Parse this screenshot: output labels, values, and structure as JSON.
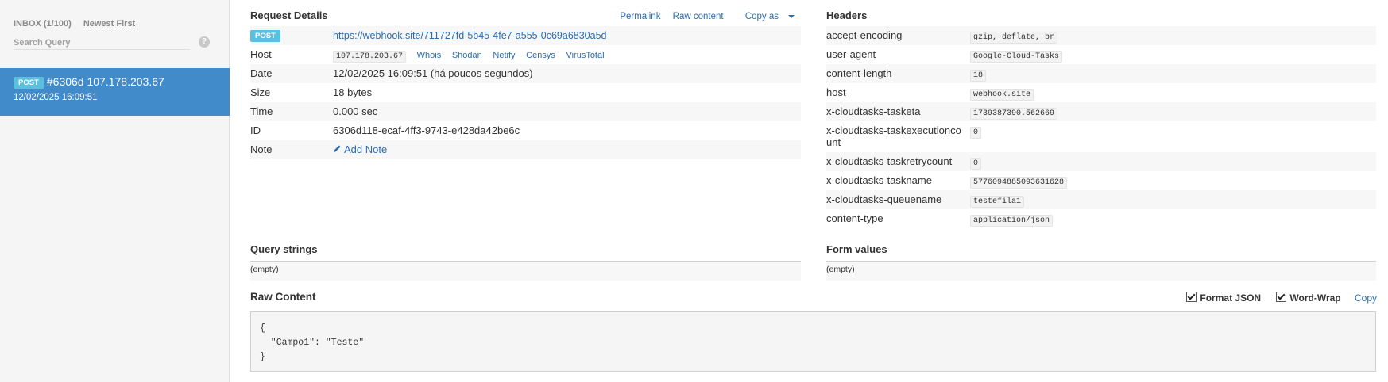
{
  "sidebar": {
    "inbox_label": "INBOX (1/100)",
    "sort_label": "Newest First",
    "search_placeholder": "Search Query",
    "help": "?",
    "selected_request": {
      "method": "POST",
      "title": "#6306d 107.178.203.67",
      "date": "12/02/2025 16:09:51"
    }
  },
  "request_details": {
    "title": "Request Details",
    "actions": {
      "permalink": "Permalink",
      "raw_content": "Raw content",
      "copy_as": "Copy as"
    },
    "method": "POST",
    "url": "https://webhook.site/711727fd-5b45-4fe7-a555-0c69a6830a5d",
    "rows": {
      "host": {
        "label": "Host",
        "value": "107.178.203.67"
      },
      "date": {
        "label": "Date",
        "value": "12/02/2025 16:09:51 (há poucos segundos)"
      },
      "size": {
        "label": "Size",
        "value": "18 bytes"
      },
      "time": {
        "label": "Time",
        "value": "0.000 sec"
      },
      "id": {
        "label": "ID",
        "value": "6306d118-ecaf-4ff3-9743-e428da42be6c"
      },
      "note": {
        "label": "Note",
        "value": "Add Note"
      }
    },
    "host_links": [
      "Whois",
      "Shodan",
      "Netify",
      "Censys",
      "VirusTotal"
    ]
  },
  "headers": {
    "title": "Headers",
    "items": [
      {
        "name": "accept-encoding",
        "value": "gzip, deflate, br"
      },
      {
        "name": "user-agent",
        "value": "Google-Cloud-Tasks"
      },
      {
        "name": "content-length",
        "value": "18"
      },
      {
        "name": "host",
        "value": "webhook.site"
      },
      {
        "name": "x-cloudtasks-tasketa",
        "value": "1739387390.562669"
      },
      {
        "name": "x-cloudtasks-taskexecutioncount",
        "value": "0"
      },
      {
        "name": "x-cloudtasks-taskretrycount",
        "value": "0"
      },
      {
        "name": "x-cloudtasks-taskname",
        "value": "5776094885093631628"
      },
      {
        "name": "x-cloudtasks-queuename",
        "value": "testefila1"
      },
      {
        "name": "content-type",
        "value": "application/json"
      }
    ]
  },
  "query_strings": {
    "title": "Query strings",
    "value": "(empty)"
  },
  "form_values": {
    "title": "Form values",
    "value": "(empty)"
  },
  "raw": {
    "title": "Raw Content",
    "format_json": "Format JSON",
    "word_wrap": "Word-Wrap",
    "copy": "Copy",
    "content": "{\n  \"Campo1\": \"Teste\"\n}"
  },
  "colors": {
    "selected_bg": "#428bca",
    "badge": "#5bc0de",
    "link": "#2a6db0"
  }
}
